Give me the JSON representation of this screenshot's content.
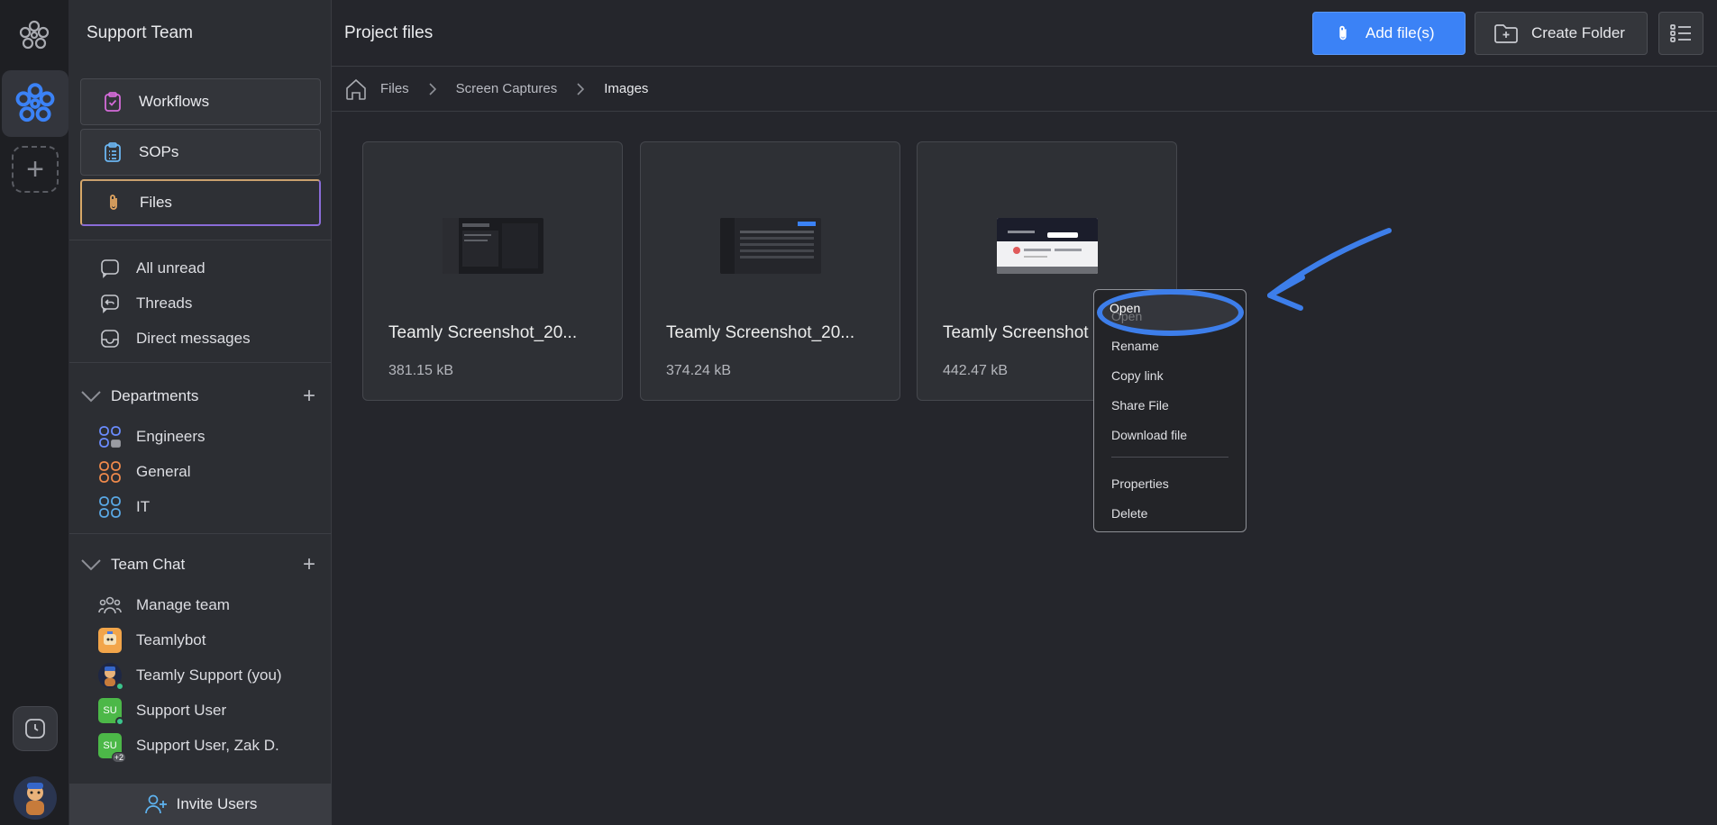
{
  "colors": {
    "accent": "#3b82f6",
    "annotation": "#3d7eea",
    "online": "#3bc48c"
  },
  "rail": {
    "logo_icon": "teamly-logo-icon",
    "add_icon": "plus-icon",
    "clock_icon": "clock-icon"
  },
  "sidebar": {
    "team_name": "Support Team",
    "primary": [
      {
        "label": "Workflows",
        "icon": "clipboard-check-icon"
      },
      {
        "label": "SOPs",
        "icon": "clipboard-list-icon"
      },
      {
        "label": "Files",
        "icon": "paperclip-icon",
        "active": true
      }
    ],
    "messages": [
      {
        "label": "All unread",
        "icon": "chat-bubble-icon"
      },
      {
        "label": "Threads",
        "icon": "thread-icon"
      },
      {
        "label": "Direct messages",
        "icon": "inbox-icon"
      }
    ],
    "departments": {
      "title": "Departments",
      "items": [
        {
          "label": "Engineers",
          "color": "#6a8cff"
        },
        {
          "label": "General",
          "color": "#f08a4b"
        },
        {
          "label": "IT",
          "color": "#5aa9e6"
        }
      ]
    },
    "team_chat": {
      "title": "Team Chat",
      "items": [
        {
          "label": "Manage team"
        },
        {
          "label": "Teamlybot"
        },
        {
          "label": "Teamly Support (you)"
        },
        {
          "label": "Support User",
          "initials": "SU"
        },
        {
          "label": "Support User, Zak D.",
          "initials": "SU",
          "extra": "+2"
        }
      ]
    },
    "invite_label": "Invite Users"
  },
  "header": {
    "title": "Project files",
    "add_files_label": "Add file(s)",
    "create_folder_label": "Create Folder"
  },
  "breadcrumb": [
    "Files",
    "Screen Captures",
    "Images"
  ],
  "files": [
    {
      "name": "Teamly Screenshot_20...",
      "size": "381.15 kB"
    },
    {
      "name": "Teamly Screenshot_20...",
      "size": "374.24 kB"
    },
    {
      "name": "Teamly Screenshot",
      "size": "442.47 kB"
    }
  ],
  "context_menu": {
    "items": [
      "Open",
      "Rename",
      "Copy link",
      "Share File",
      "Download file"
    ],
    "items2": [
      "Properties",
      "Delete"
    ]
  }
}
